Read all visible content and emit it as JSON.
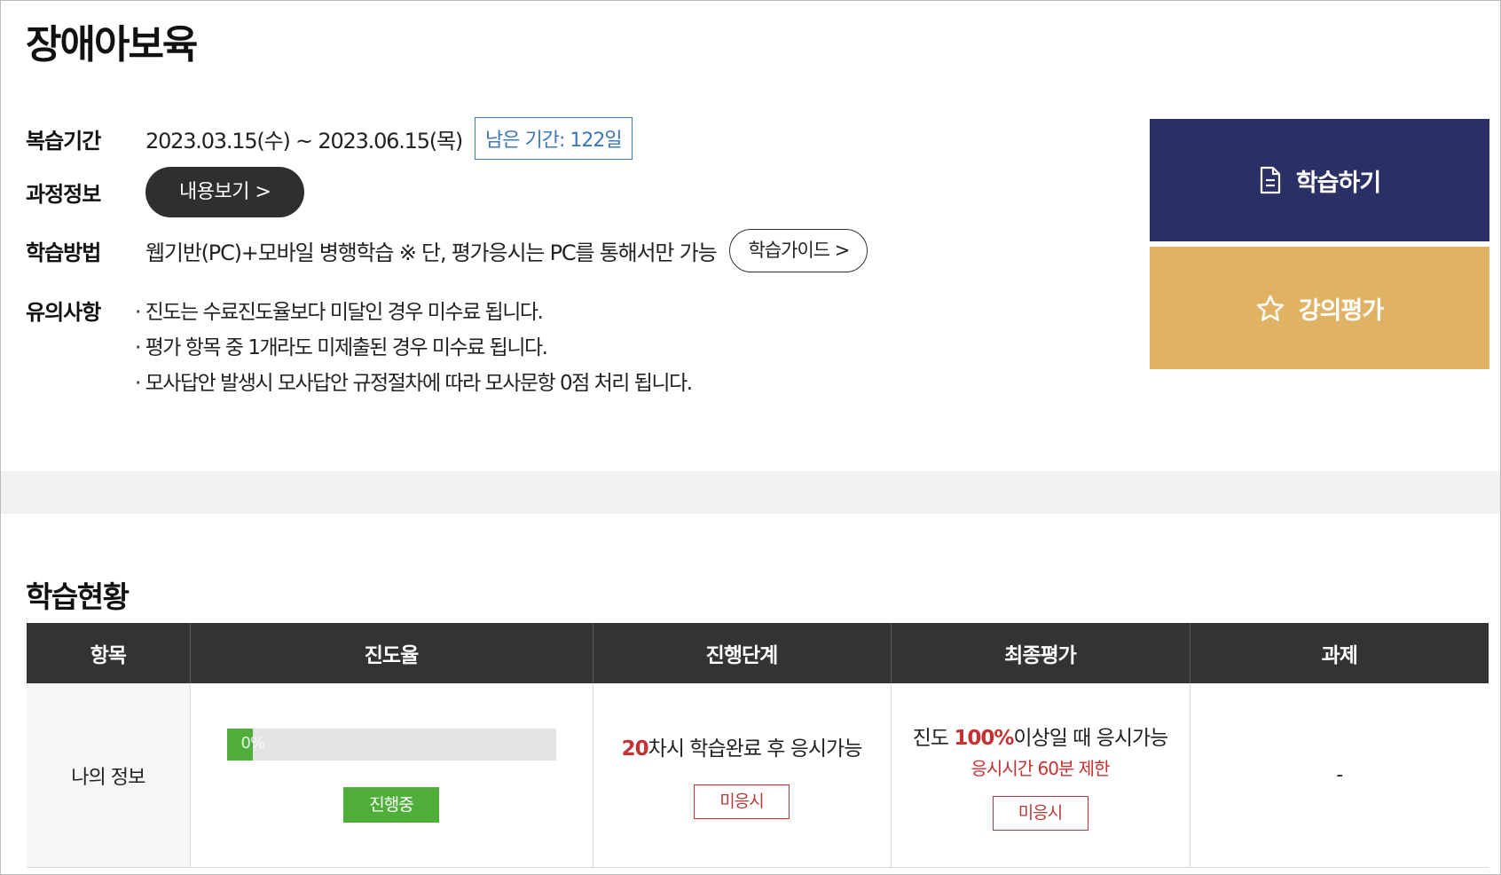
{
  "page": {
    "title": "장애아보육"
  },
  "info": {
    "review_period": {
      "label": "복습기간",
      "value": "2023.03.15(수) ~ 2023.06.15(목)",
      "remaining": "남은 기간: 122일"
    },
    "course_info": {
      "label": "과정정보",
      "button": "내용보기 >"
    },
    "study_method": {
      "label": "학습방법",
      "value": "웹기반(PC)+모바일 병행학습 ※ 단, 평가응시는 PC를 통해서만 가능",
      "button": "학습가이드 >"
    },
    "notes": {
      "label": "유의사항",
      "items": [
        "진도는 수료진도율보다 미달인 경우 미수료 됩니다.",
        "평가 항목 중 1개라도 미제출된 경우 미수료 됩니다.",
        "모사답안 발생시 모사답안 규정절차에 따라 모사문항 0점 처리 됩니다."
      ]
    }
  },
  "actions": {
    "study": {
      "label": "학습하기",
      "color": "#2a2f66"
    },
    "review": {
      "label": "강의평가",
      "color": "#dfb363"
    }
  },
  "status": {
    "title": "학습현황",
    "headers": [
      "항목",
      "진도율",
      "진행단계",
      "최종평가",
      "과제"
    ],
    "row": {
      "item": "나의 정보",
      "progress": {
        "value": 0,
        "label": "0%",
        "status": "진행중"
      },
      "stage": {
        "count": "20",
        "text": "차시 학습완료 후 응시가능",
        "status": "미응시"
      },
      "final": {
        "prefix": "진도 ",
        "percent": "100%",
        "suffix": "이상일 때 응시가능",
        "limit": "응시시간 60분 제한",
        "status": "미응시"
      },
      "assignment": "-"
    }
  }
}
